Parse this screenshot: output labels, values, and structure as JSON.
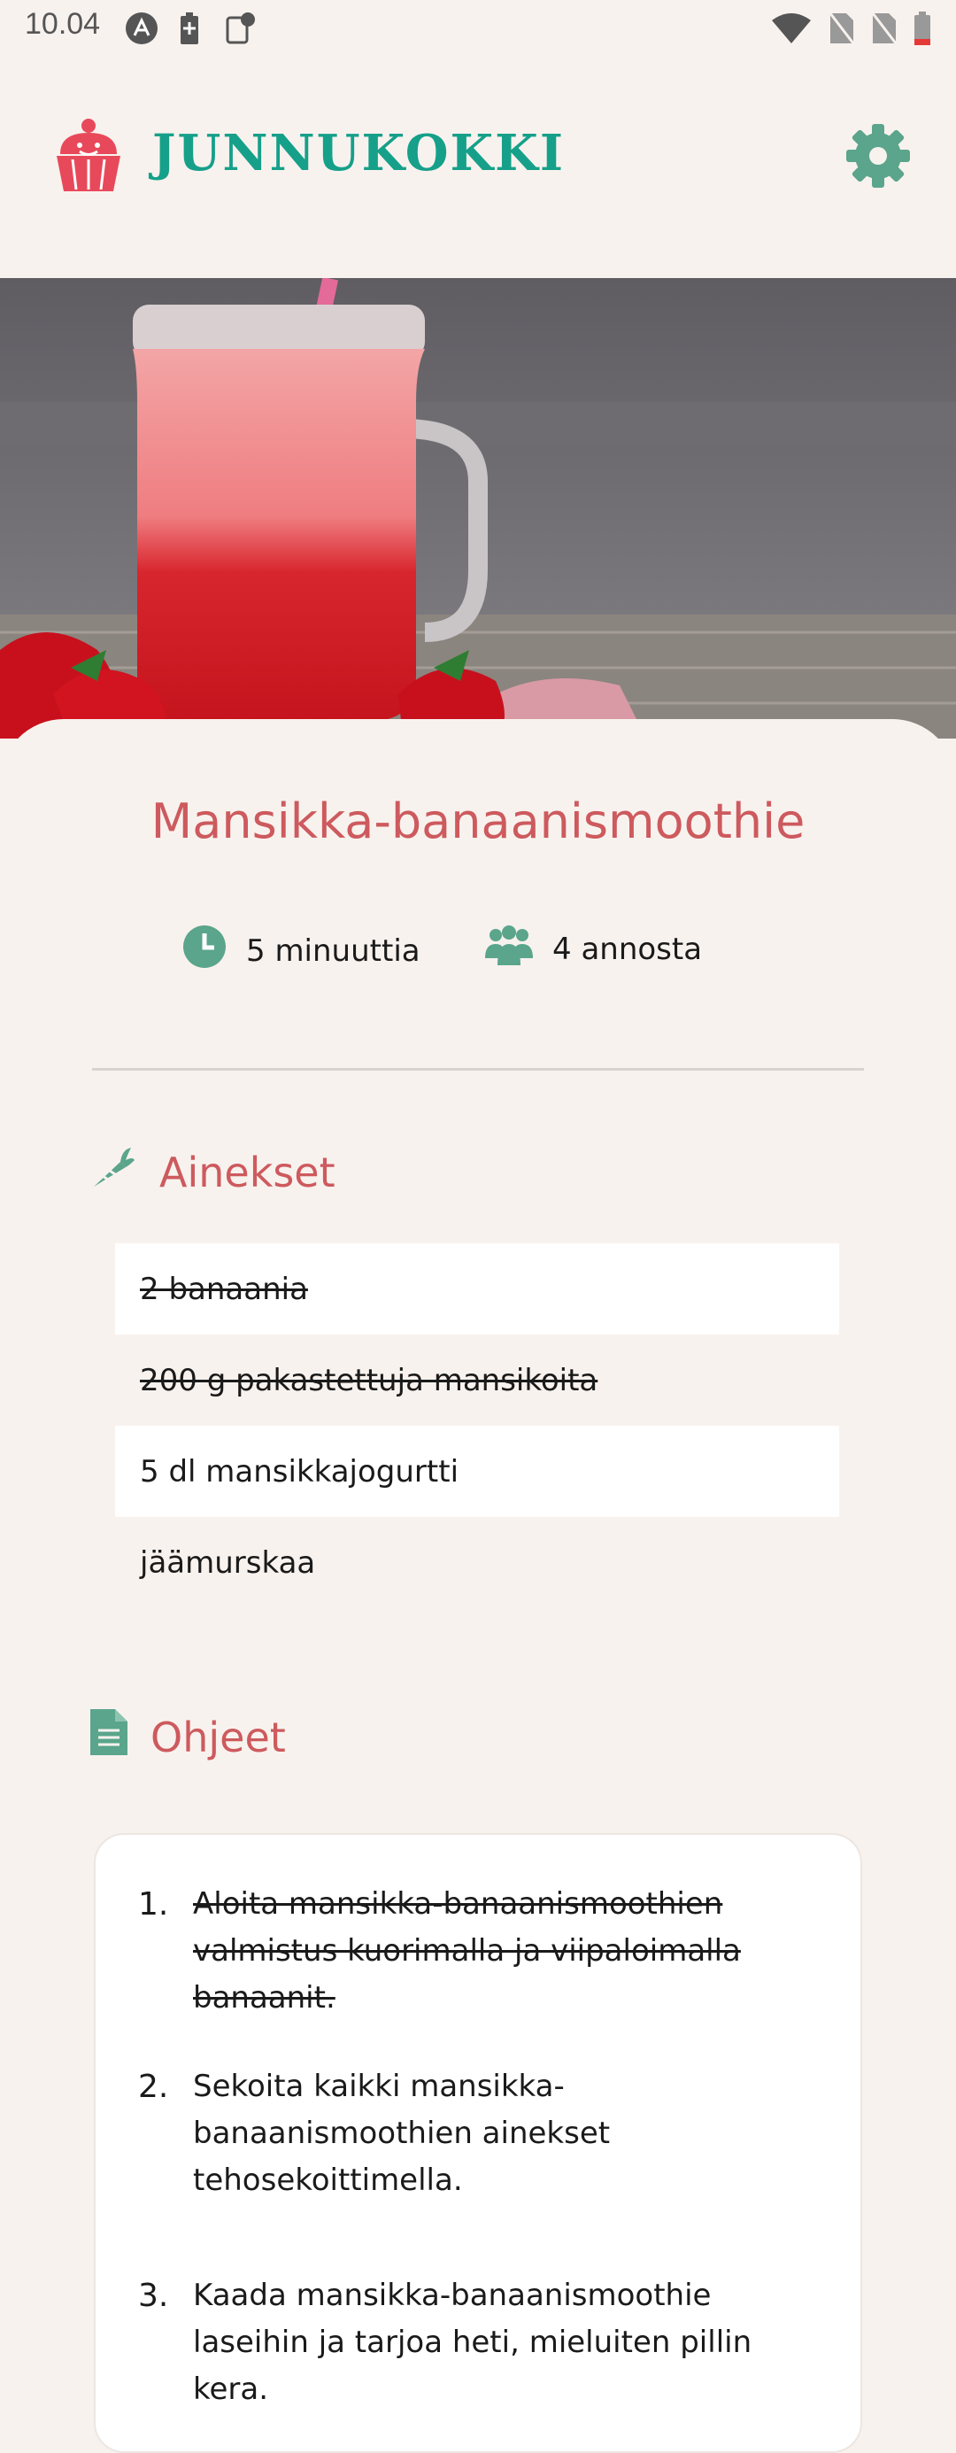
{
  "status_bar": {
    "time": "10.04",
    "icons": [
      "notification-a-icon",
      "battery-saver-icon",
      "screenshot-icon",
      "wifi-icon",
      "no-sim-icon",
      "no-sim-icon",
      "battery-low-icon"
    ]
  },
  "app": {
    "brand": "JUNNUKOKKI",
    "brand_color": "#16a08a",
    "accent_color": "#cd5a5e",
    "icons": {
      "logo": "cupcake-icon",
      "settings": "gear-icon"
    }
  },
  "recipe": {
    "title": "Mansikka-banaanismoothie",
    "time": "5 minuuttia",
    "servings": "4 annosta",
    "meta_icons": {
      "time": "clock-icon",
      "servings": "people-icon"
    }
  },
  "ingredients": {
    "heading": "Ainekset",
    "icon": "carrot-icon",
    "items": [
      {
        "text": "2 banaania",
        "checked": true
      },
      {
        "text": "200 g pakastettuja mansikoita",
        "checked": true
      },
      {
        "text": "5 dl mansikkajogurtti",
        "checked": false
      },
      {
        "text": "jäämurskaa",
        "checked": false
      }
    ]
  },
  "instructions": {
    "heading": "Ohjeet",
    "icon": "document-icon",
    "steps": [
      {
        "num": "1.",
        "text": "Aloita mansikka-banaanismoothien valmistus kuorimalla ja viipaloimalla banaanit.",
        "done": true
      },
      {
        "num": "2.",
        "text": "Sekoita kaikki mansikka-banaanismoothien ainekset tehosekoittimella.",
        "done": false
      },
      {
        "num": "3.",
        "text": "Kaada mansikka-banaanismoothie laseihin ja tarjoa heti, mieluiten pillin kera.",
        "done": false
      }
    ]
  }
}
